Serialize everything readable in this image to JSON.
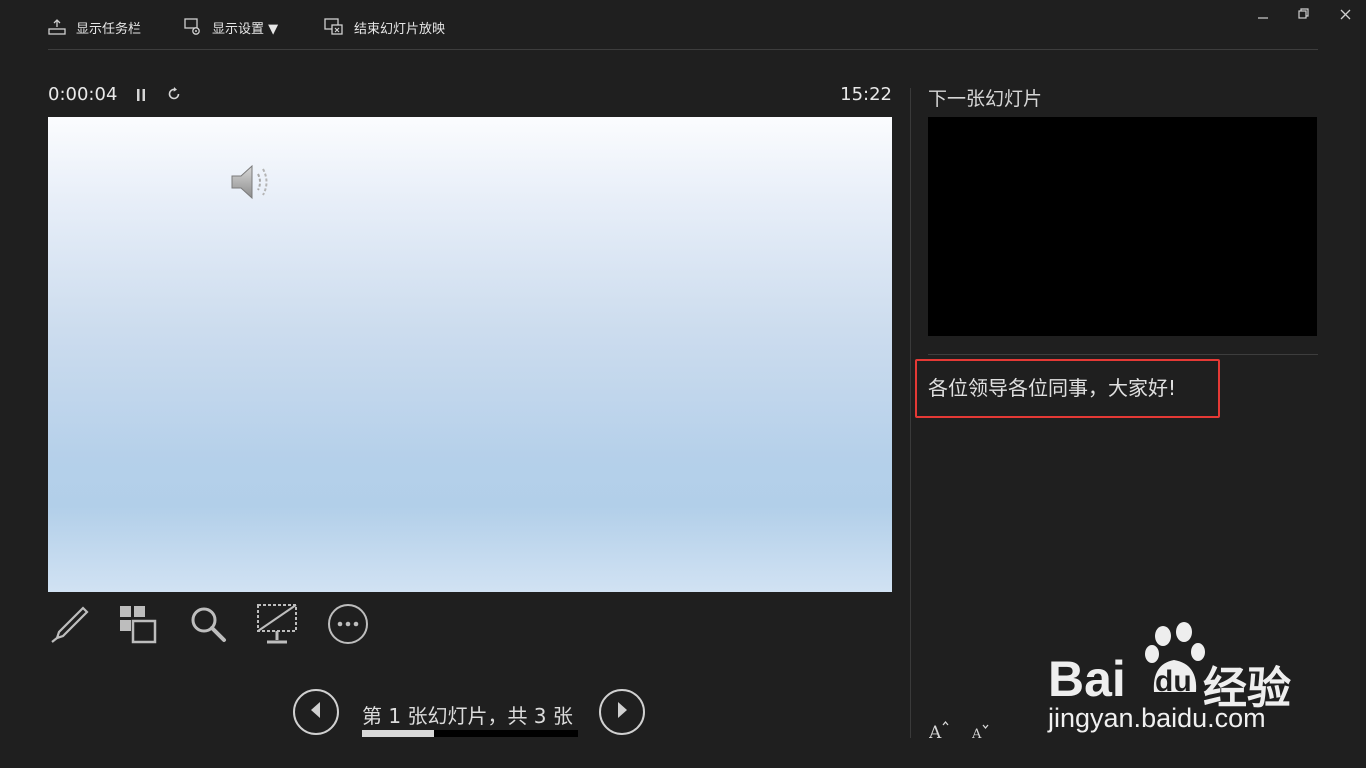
{
  "toolbar": {
    "show_taskbar": "显示任务栏",
    "display_settings": "显示设置 ▼",
    "end_slideshow": "结束幻灯片放映"
  },
  "window_controls": {
    "minimize_icon": "minimize-icon",
    "restore_icon": "restore-icon",
    "close_icon": "close-icon"
  },
  "presenter": {
    "elapsed_time": "0:00:04",
    "clock": "15:22",
    "counter_text": "第 1 张幻灯片，共 3 张",
    "current_slide": 1,
    "total_slides": 3,
    "progress_fraction": 0.333
  },
  "next_slide": {
    "label": "下一张幻灯片"
  },
  "notes": {
    "text": "各位领导各位同事，大家好!",
    "highlight_color": "#e53935"
  },
  "watermark": {
    "logo_text_left": "Bai",
    "logo_text_du": "du",
    "logo_text_right": "经验",
    "url": "jingyan.baidu.com"
  },
  "icons": {
    "pen": "pen-icon",
    "see_all_slides": "slides-grid-icon",
    "zoom": "zoom-icon",
    "black_screen": "black-screen-icon",
    "more": "more-options-icon",
    "prev": "previous-slide-icon",
    "next": "next-slide-icon",
    "font_up": "increase-font-icon",
    "font_down": "decrease-font-icon"
  },
  "colors": {
    "background": "#1f1f1f",
    "accent_red": "#e53935"
  }
}
